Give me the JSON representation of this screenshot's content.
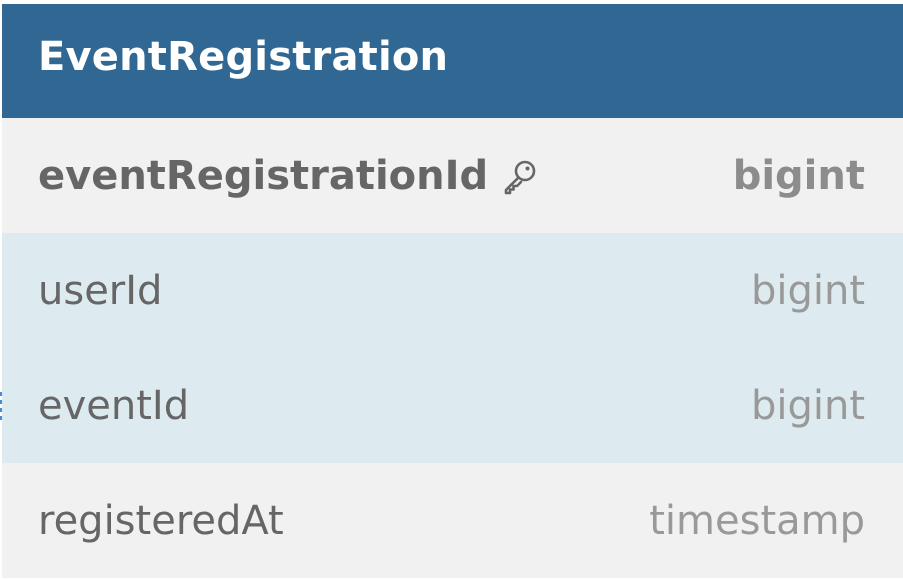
{
  "table": {
    "name": "EventRegistration",
    "fields": [
      {
        "name": "eventRegistrationId",
        "type": "bigint",
        "primary_key": true,
        "highlighted": false
      },
      {
        "name": "userId",
        "type": "bigint",
        "primary_key": false,
        "highlighted": true
      },
      {
        "name": "eventId",
        "type": "bigint",
        "primary_key": false,
        "highlighted": true
      },
      {
        "name": "registeredAt",
        "type": "timestamp",
        "primary_key": false,
        "highlighted": false
      }
    ]
  },
  "colors": {
    "header_bg": "#306893",
    "row_bg": "#f1f1f1",
    "highlight_bg": "#ddebf1",
    "text": "#666666",
    "type_text": "#999999"
  },
  "icons": {
    "primary_key": "key-icon"
  }
}
